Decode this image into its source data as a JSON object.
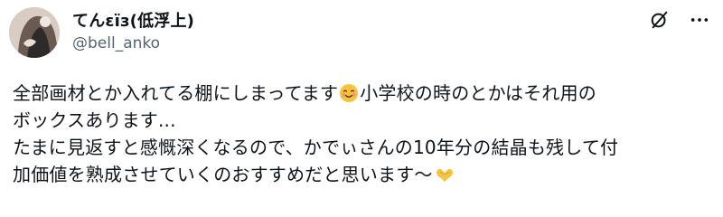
{
  "post": {
    "author": {
      "display_name": "てんεïз(低浮上)",
      "handle": "@bell_anko",
      "avatar_icon": "avatar-image"
    },
    "actions": {
      "grok_icon": "grok-icon",
      "more_icon": "more-horizontal-icon"
    },
    "text": {
      "line1_a": "全部画材とか入れてる棚にしまってます",
      "line1_b": "小学校の時のとかはそれ用の",
      "line2": "ボックスあります...",
      "line3": "たまに見返すと感慨深くなるので、かでぃさんの10年分の結晶も残して付",
      "line4": "加価値を熟成させていくのおすすめだと思います〜"
    },
    "emojis": {
      "smiling_face": "smiling-face-with-hearts-emoji",
      "heart_hands": "heart-hands-emoji"
    },
    "colors": {
      "text": "#0f1419",
      "muted": "#536471"
    }
  }
}
